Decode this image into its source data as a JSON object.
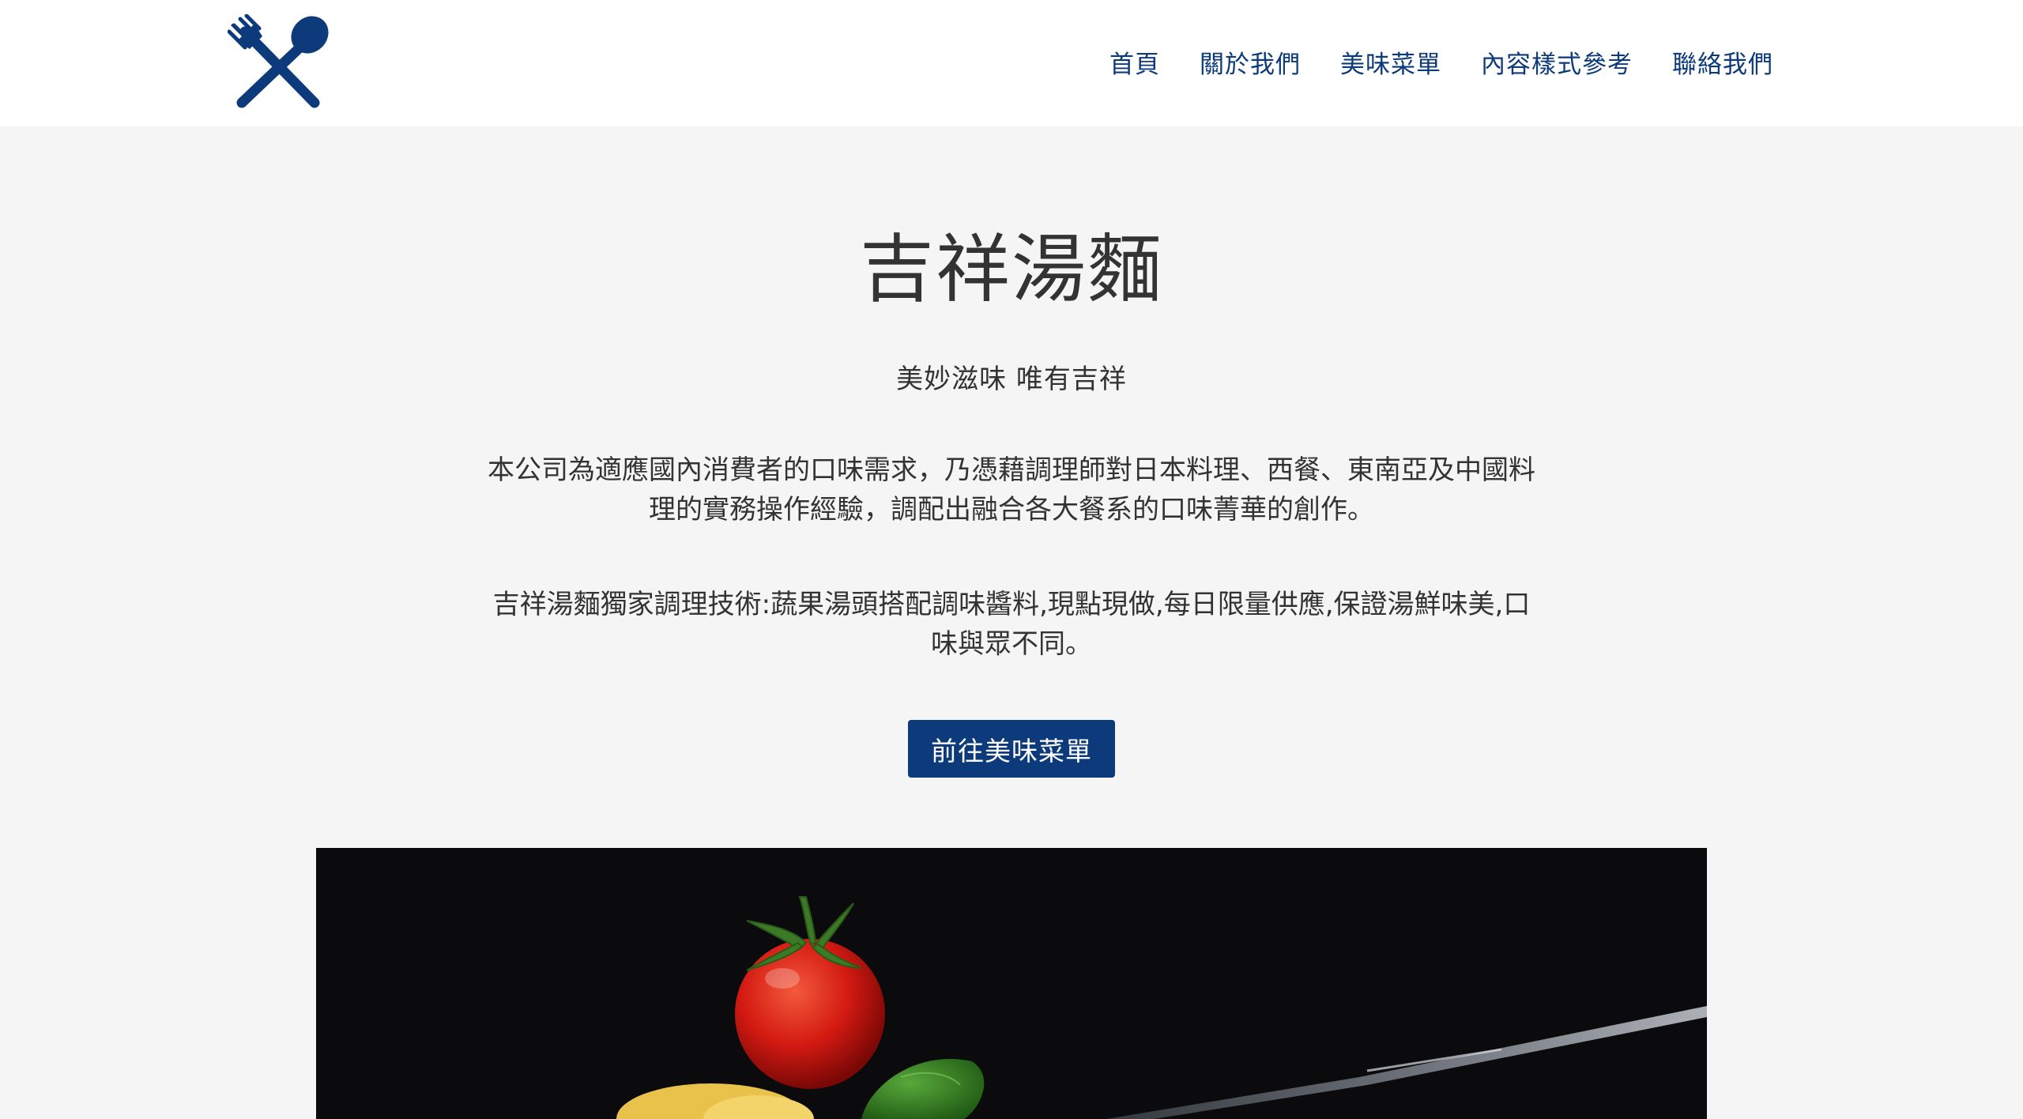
{
  "header": {
    "logo_icon": "fork-and-spoon-icon",
    "nav": [
      {
        "label": "首頁"
      },
      {
        "label": "關於我們"
      },
      {
        "label": "美味菜單"
      },
      {
        "label": "內容樣式參考"
      },
      {
        "label": "聯絡我們"
      }
    ]
  },
  "hero": {
    "title": "吉祥湯麵",
    "subtitle": "美妙滋味 唯有吉祥",
    "paragraph_1": "本公司為適應國內消費者的口味需求，乃憑藉調理師對日本料理、西餐、東南亞及中國料理的實務操作經驗，調配出融合各大餐系的口味菁華的創作。",
    "paragraph_2": "吉祥湯麵獨家調理技術:蔬果湯頭搭配調味醬料,現點現做,每日限量供應,保證湯鮮味美,口味與眾不同。",
    "cta_label": "前往美味菜單"
  },
  "colors": {
    "brand": "#0d3a7a",
    "background": "#f5f5f5",
    "text": "#333333"
  }
}
